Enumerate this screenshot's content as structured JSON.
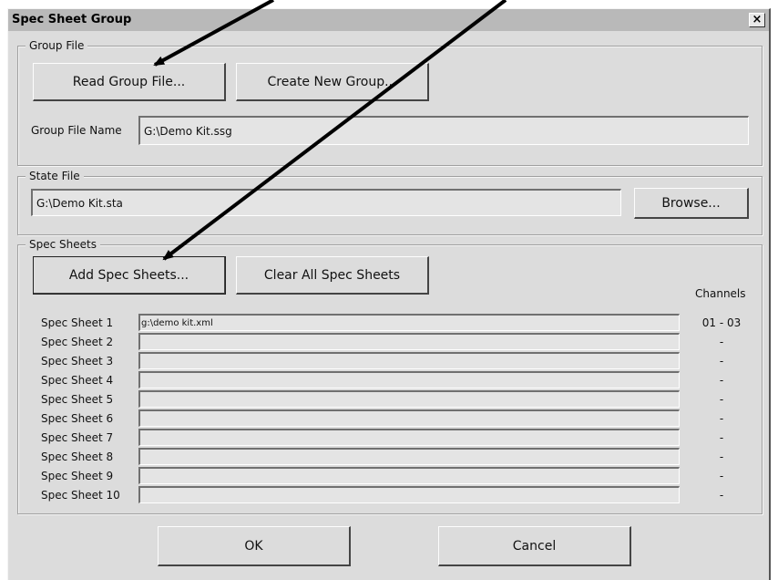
{
  "window": {
    "title": "Spec Sheet Group",
    "close_glyph": "×"
  },
  "group_file": {
    "legend": "Group File",
    "read_button": "Read Group File...",
    "create_button": "Create New Group...",
    "name_label": "Group File Name",
    "name_value": "G:\\Demo Kit.ssg"
  },
  "state_file": {
    "legend": "State File",
    "path_value": "G:\\Demo Kit.sta",
    "browse_button": "Browse..."
  },
  "spec_sheets": {
    "legend": "Spec Sheets",
    "add_button": "Add Spec Sheets...",
    "clear_button": "Clear All Spec Sheets",
    "channels_header": "Channels",
    "rows": [
      {
        "label": "Spec Sheet 1",
        "value": "g:\\demo kit.xml",
        "channels": "01 - 03"
      },
      {
        "label": "Spec Sheet 2",
        "value": "",
        "channels": "-"
      },
      {
        "label": "Spec Sheet 3",
        "value": "",
        "channels": "-"
      },
      {
        "label": "Spec Sheet 4",
        "value": "",
        "channels": "-"
      },
      {
        "label": "Spec Sheet 5",
        "value": "",
        "channels": "-"
      },
      {
        "label": "Spec Sheet 6",
        "value": "",
        "channels": "-"
      },
      {
        "label": "Spec Sheet 7",
        "value": "",
        "channels": "-"
      },
      {
        "label": "Spec Sheet 8",
        "value": "",
        "channels": "-"
      },
      {
        "label": "Spec Sheet 9",
        "value": "",
        "channels": "-"
      },
      {
        "label": "Spec Sheet 10",
        "value": "",
        "channels": "-"
      }
    ]
  },
  "footer": {
    "ok_button": "OK",
    "cancel_button": "Cancel"
  },
  "annotations": {
    "arrow_color": "#000000"
  }
}
